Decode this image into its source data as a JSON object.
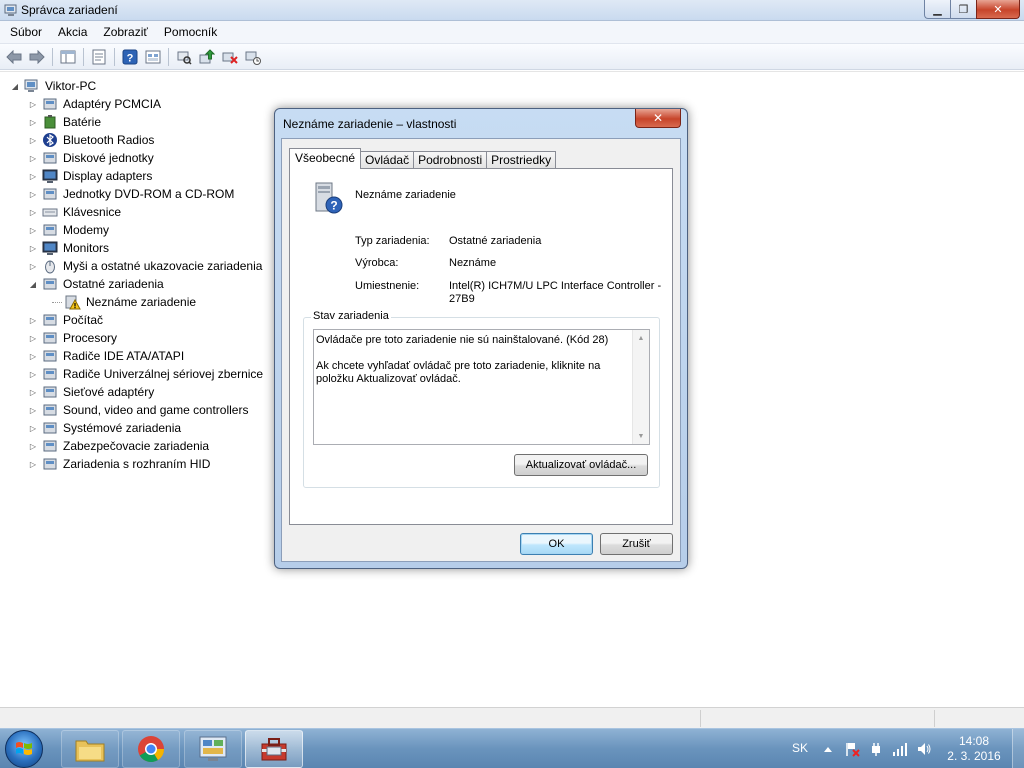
{
  "window": {
    "title": "Správca zariadení",
    "minimize_glyph": "▁",
    "maximize_glyph": "❐",
    "close_glyph": "✕"
  },
  "menu": [
    "Súbor",
    "Akcia",
    "Zobraziť",
    "Pomocník"
  ],
  "toolbar": {
    "icons": [
      "back-arrow-icon",
      "forward-arrow-icon",
      "show-hide-console-tree-icon",
      "properties-icon",
      "help-icon",
      "scan-hardware-icon",
      "update-driver-icon",
      "disable-device-icon",
      "uninstall-device-icon"
    ]
  },
  "tree": {
    "root": "Viktor-PC",
    "categories": [
      {
        "label": "Adaptéry PCMCIA",
        "icon": "pcmcia-icon"
      },
      {
        "label": "Batérie",
        "icon": "battery-icon"
      },
      {
        "label": "Bluetooth Radios",
        "icon": "bluetooth-icon"
      },
      {
        "label": "Diskové jednotky",
        "icon": "disk-drive-icon"
      },
      {
        "label": "Display adapters",
        "icon": "display-adapter-icon"
      },
      {
        "label": "Jednotky DVD-ROM a CD-ROM",
        "icon": "dvd-drive-icon"
      },
      {
        "label": "Klávesnice",
        "icon": "keyboard-icon"
      },
      {
        "label": "Modemy",
        "icon": "modem-icon"
      },
      {
        "label": "Monitors",
        "icon": "monitor-icon"
      },
      {
        "label": "Myši a ostatné ukazovacie zariadenia",
        "icon": "mouse-icon"
      },
      {
        "label": "Ostatné zariadenia",
        "icon": "other-devices-icon",
        "expanded": true
      },
      {
        "label": "Neznáme zariadenie",
        "icon": "unknown-device-warning-icon",
        "child": true
      },
      {
        "label": "Počítač",
        "icon": "computer-icon"
      },
      {
        "label": "Procesory",
        "icon": "processor-icon"
      },
      {
        "label": "Radiče IDE ATA/ATAPI",
        "icon": "ide-controller-icon"
      },
      {
        "label": "Radiče Univerzálnej sériovej zbernice",
        "icon": "usb-controller-icon"
      },
      {
        "label": "Sieťové adaptéry",
        "icon": "network-adapter-icon"
      },
      {
        "label": "Sound, video and game controllers",
        "icon": "sound-icon"
      },
      {
        "label": "Systémové zariadenia",
        "icon": "system-devices-icon"
      },
      {
        "label": "Zabezpečovacie zariadenia",
        "icon": "security-devices-icon"
      },
      {
        "label": "Zariadenia s rozhraním HID",
        "icon": "hid-icon"
      }
    ]
  },
  "dialog": {
    "title": "Neznáme zariadenie – vlastnosti",
    "close_glyph": "✕",
    "tabs": [
      "Všeobecné",
      "Ovládač",
      "Podrobnosti",
      "Prostriedky"
    ],
    "device_name": "Neznáme zariadenie",
    "props": [
      {
        "label": "Typ zariadenia:",
        "value": "Ostatné zariadenia"
      },
      {
        "label": "Výrobca:",
        "value": "Neznáme"
      },
      {
        "label": "Umiestnenie:",
        "value": "Intel(R) ICH7M/U LPC Interface Controller - 27B9"
      }
    ],
    "status_group_label": "Stav zariadenia",
    "status_line1": "Ovládače pre toto zariadenie nie sú nainštalované. (Kód 28)",
    "status_line2": "Ak chcete vyhľadať ovládač pre toto zariadenie, kliknite na položku Aktualizovať ovládač.",
    "update_button": "Aktualizovať ovládač...",
    "ok_button": "OK",
    "cancel_button": "Zrušiť"
  },
  "taskbar": {
    "language": "SK",
    "time": "14:08",
    "date": "2. 3. 2016",
    "buttons": [
      "file-explorer-icon",
      "chrome-icon",
      "control-panel-icon",
      "device-manager-toolbox-icon"
    ]
  }
}
